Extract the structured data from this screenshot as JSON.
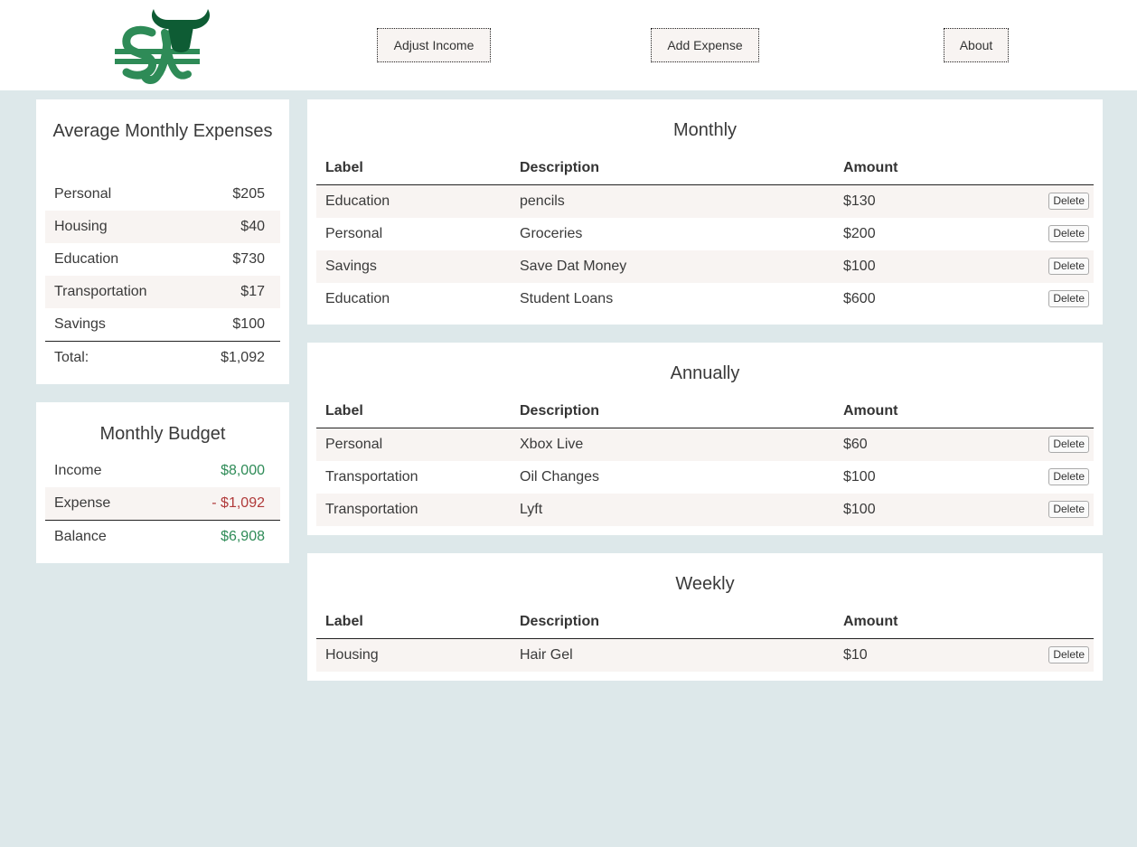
{
  "header": {
    "logo_name": "bull-dollar-logo",
    "buttons": {
      "adjust_income": "Adjust Income",
      "add_expense": "Add Expense",
      "about": "About"
    }
  },
  "colors": {
    "brand_green": "#2e8b57",
    "logo_dark_green": "#0e5c34",
    "negative_red": "#b03a3a",
    "background": "#dde8ea",
    "row_alt": "#f8f4f2"
  },
  "average_monthly": {
    "title": "Average Monthly Expenses",
    "rows": [
      {
        "label": "Personal",
        "value": "$205"
      },
      {
        "label": "Housing",
        "value": "$40"
      },
      {
        "label": "Education",
        "value": "$730"
      },
      {
        "label": "Transportation",
        "value": "$17"
      },
      {
        "label": "Savings",
        "value": "$100"
      }
    ],
    "total_label": "Total:",
    "total_value": "$1,092"
  },
  "budget": {
    "title": "Monthly Budget",
    "income_label": "Income",
    "income_value": "$8,000",
    "expense_label": "Expense",
    "expense_value": "- $1,092",
    "balance_label": "Balance",
    "balance_value": "$6,908"
  },
  "columns": {
    "label": "Label",
    "description": "Description",
    "amount": "Amount"
  },
  "delete_label": "Delete",
  "monthly": {
    "title": "Monthly",
    "rows": [
      {
        "label": "Education",
        "description": "pencils",
        "amount": "$130"
      },
      {
        "label": "Personal",
        "description": "Groceries",
        "amount": "$200"
      },
      {
        "label": "Savings",
        "description": "Save Dat Money",
        "amount": "$100"
      },
      {
        "label": "Education",
        "description": "Student Loans",
        "amount": "$600"
      }
    ]
  },
  "annually": {
    "title": "Annually",
    "rows": [
      {
        "label": "Personal",
        "description": "Xbox Live",
        "amount": "$60"
      },
      {
        "label": "Transportation",
        "description": "Oil Changes",
        "amount": "$100"
      },
      {
        "label": "Transportation",
        "description": "Lyft",
        "amount": "$100"
      }
    ]
  },
  "weekly": {
    "title": "Weekly",
    "rows": [
      {
        "label": "Housing",
        "description": "Hair Gel",
        "amount": "$10"
      }
    ]
  }
}
